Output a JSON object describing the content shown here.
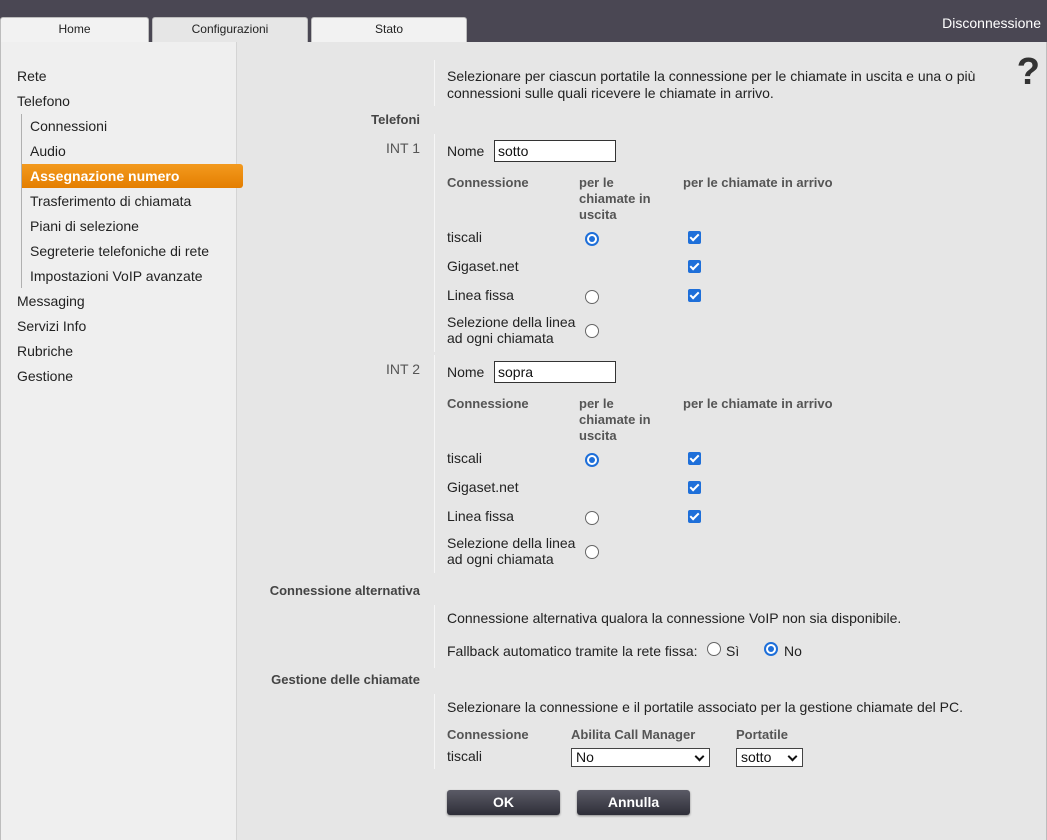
{
  "tabs": [
    {
      "label": "Home"
    },
    {
      "label": "Configurazioni"
    },
    {
      "label": "Stato"
    }
  ],
  "logout_label": "Disconnessione",
  "help_icon": "?",
  "sidebar": {
    "items": [
      "Rete",
      "Telefono"
    ],
    "sub_items": [
      "Connessioni",
      "Audio",
      "Assegnazione numero",
      "Trasferimento di chiamata",
      "Piani di selezione",
      "Segreterie telefoniche di rete",
      "Impostazioni VoIP avanzate"
    ],
    "bottom_items": [
      "Messaging",
      "Servizi Info",
      "Rubriche",
      "Gestione"
    ]
  },
  "intro_text_1": "Selezionare per ciascun portatile la connessione per le chiamate in uscita e una o più",
  "intro_text_2": "connessioni sulle quali ricevere le chiamate in arrivo.",
  "sections": {
    "telefoni": "Telefoni",
    "alternativa": "Connessione alternativa",
    "gestione": "Gestione delle chiamate"
  },
  "handsets": [
    {
      "int_label": "INT 1",
      "name_label": "Nome",
      "name_value": "sotto",
      "col_connessione": "Connessione",
      "col_uscita_1": "per le",
      "col_uscita_2": "chiamate in",
      "col_uscita_3": "uscita",
      "col_arrivo": "per le chiamate in arrivo",
      "rows": [
        {
          "name": "tiscali",
          "outgoing": true,
          "incoming": true
        },
        {
          "name": "Gigaset.net",
          "outgoing": null,
          "incoming": true
        },
        {
          "name": "Linea fissa",
          "outgoing": false,
          "incoming": true
        }
      ],
      "sel_line_1": "Selezione della linea",
      "sel_line_2": "ad ogni chiamata"
    },
    {
      "int_label": "INT 2",
      "name_label": "Nome",
      "name_value": "sopra",
      "col_connessione": "Connessione",
      "col_uscita_1": "per le",
      "col_uscita_2": "chiamate in",
      "col_uscita_3": "uscita",
      "col_arrivo": "per le chiamate in arrivo",
      "rows": [
        {
          "name": "tiscali",
          "outgoing": true,
          "incoming": true
        },
        {
          "name": "Gigaset.net",
          "outgoing": null,
          "incoming": true
        },
        {
          "name": "Linea fissa",
          "outgoing": false,
          "incoming": true
        }
      ],
      "sel_line_1": "Selezione della linea",
      "sel_line_2": "ad ogni chiamata"
    }
  ],
  "alternativa": {
    "text": "Connessione alternativa qualora la connessione VoIP non sia disponibile.",
    "fallback_label": "Fallback automatico tramite la rete fissa:",
    "opt_si": "Sì",
    "opt_no": "No",
    "selected": "No"
  },
  "gestione": {
    "text": "Selezionare la connessione e il portatile associato per la gestione chiamate del PC.",
    "col_connessione": "Connessione",
    "col_call_manager": "Abilita Call Manager",
    "col_portatile": "Portatile",
    "row_connessione": "tiscali",
    "call_manager_value": "No",
    "portatile_value": "sotto"
  },
  "buttons": {
    "ok": "OK",
    "annulla": "Annulla"
  },
  "colors": {
    "accent": "#f08c00",
    "topbar": "#4a4753",
    "control": "#1e6fd9"
  }
}
